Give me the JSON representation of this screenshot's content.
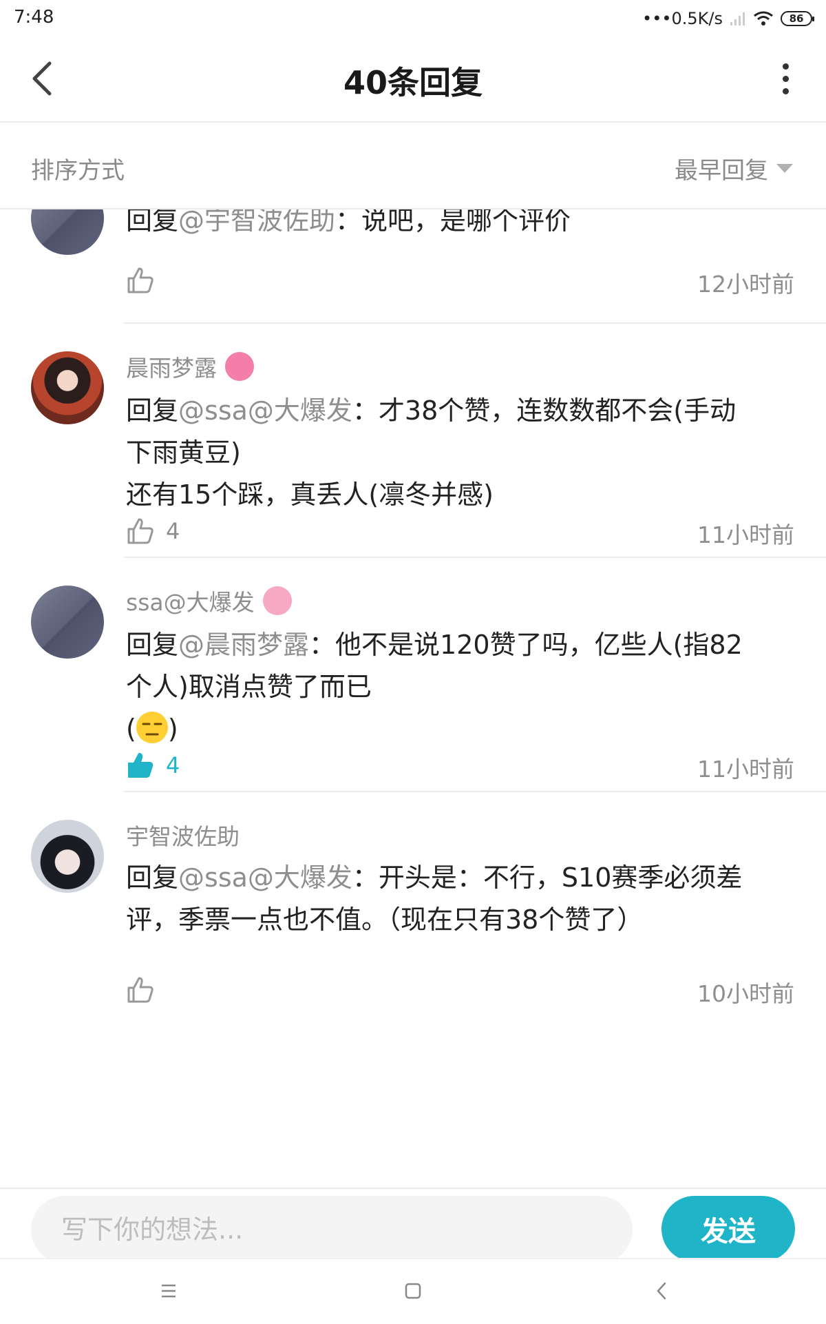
{
  "status_bar": {
    "time": "7:48",
    "network_speed": "0.5K/s",
    "battery": "86"
  },
  "header": {
    "title": "40条回复"
  },
  "sort": {
    "label": "排序方式",
    "selected": "最早回复"
  },
  "comments": [
    {
      "username": "",
      "reply_prefix": "回复",
      "mention": "@宇智波佐助",
      "separator": "：",
      "text": "说吧，是哪个评价",
      "likes": "",
      "time": "12小时前"
    },
    {
      "username": "晨雨梦露",
      "reply_prefix": "回复",
      "mention": "@ssa@大爆发",
      "separator": "：",
      "text_line1": "才38个赞，连数数都不会(手动",
      "text_line2": "下雨黄豆)",
      "text_line3": "还有15个踩，真丢人(凛冬并感)",
      "likes": "4",
      "time": "11小时前"
    },
    {
      "username": "ssa@大爆发",
      "reply_prefix": "回复",
      "mention": "@晨雨梦露",
      "separator": "：",
      "text_line1": "他不是说120赞了吗，亿些人(指82",
      "text_line2": "个人)取消点赞了而已",
      "text_line3_open": "(",
      "text_line3_close": ")",
      "likes": "4",
      "liked": true,
      "time": "11小时前"
    },
    {
      "username": "宇智波佐助",
      "reply_prefix": "回复",
      "mention": "@ssa@大爆发",
      "separator": "：",
      "text_line1": "开头是：不行，S10赛季必须差",
      "text_line2": "评，季票一点也不值。（现在只有38个赞了）",
      "likes": "",
      "time": "10小时前"
    }
  ],
  "composer": {
    "placeholder": "写下你的想法...",
    "send_label": "发送"
  },
  "colors": {
    "accent": "#1fb4c8",
    "muted_text": "#8e8e8e",
    "divider": "#ececec"
  },
  "icons": [
    "back-icon",
    "more-icon",
    "caret-down-icon",
    "thumbs-up-icon",
    "wifi-icon",
    "signal-icon",
    "battery-icon",
    "menu-icon",
    "home-icon",
    "back-nav-icon"
  ]
}
